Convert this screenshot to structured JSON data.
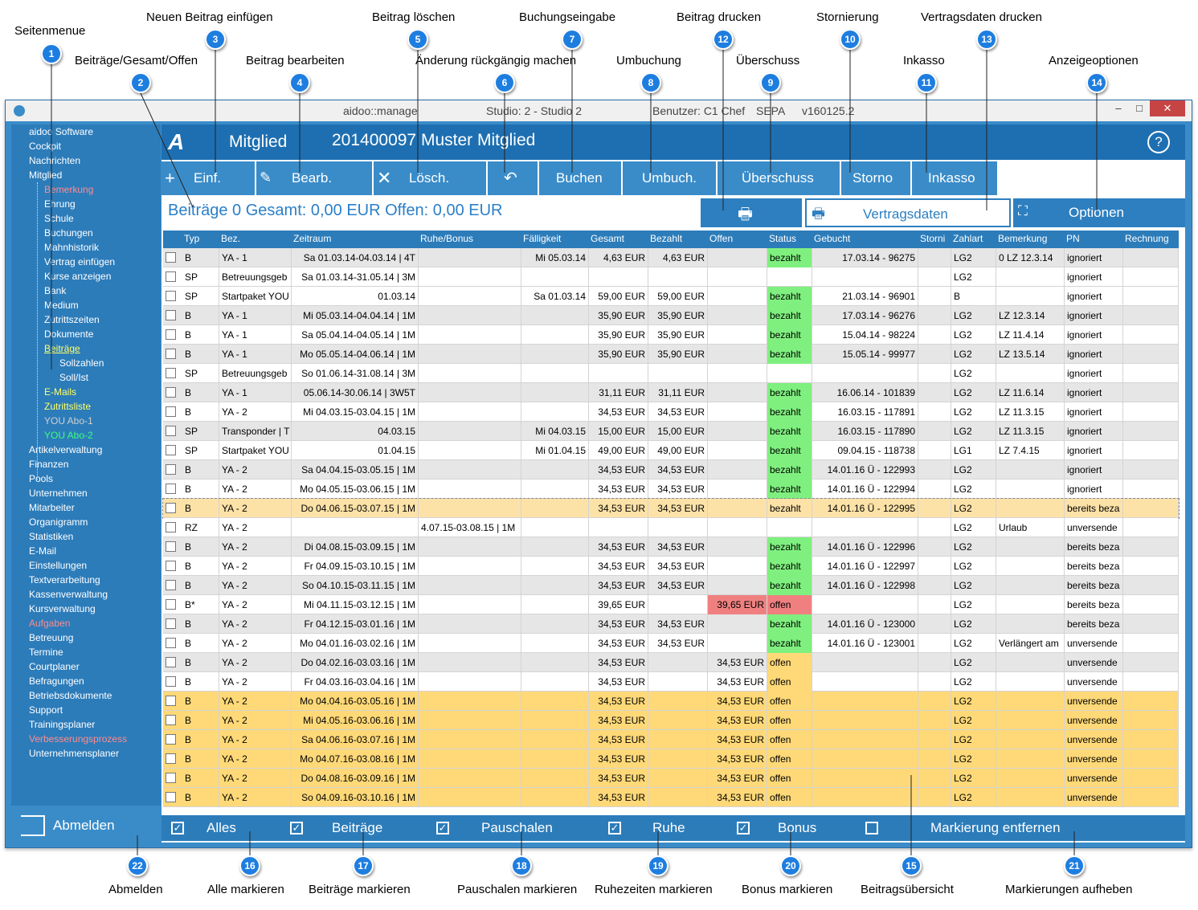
{
  "callouts": [
    {
      "n": "1",
      "text": "Seitenmenue"
    },
    {
      "n": "2",
      "text": "Beiträge/Gesamt/Offen"
    },
    {
      "n": "3",
      "text": "Neuen Beitrag einfügen"
    },
    {
      "n": "4",
      "text": "Beitrag bearbeiten"
    },
    {
      "n": "5",
      "text": "Beitrag löschen"
    },
    {
      "n": "6",
      "text": "Änderung rückgängig machen"
    },
    {
      "n": "7",
      "text": "Buchungseingabe"
    },
    {
      "n": "8",
      "text": "Umbuchung"
    },
    {
      "n": "9",
      "text": "Überschuss"
    },
    {
      "n": "10",
      "text": "Stornierung"
    },
    {
      "n": "11",
      "text": "Inkasso"
    },
    {
      "n": "12",
      "text": "Beitrag drucken"
    },
    {
      "n": "13",
      "text": "Vertragsdaten drucken"
    },
    {
      "n": "14",
      "text": "Anzeigeoptionen"
    },
    {
      "n": "15",
      "text": "Beitragsübersicht"
    },
    {
      "n": "16",
      "text": "Alle markieren"
    },
    {
      "n": "17",
      "text": "Beiträge markieren"
    },
    {
      "n": "18",
      "text": "Pauschalen markieren"
    },
    {
      "n": "19",
      "text": "Ruhezeiten markieren"
    },
    {
      "n": "20",
      "text": "Bonus markieren"
    },
    {
      "n": "21",
      "text": "Markierungen aufheben"
    },
    {
      "n": "22",
      "text": "Abmelden"
    }
  ],
  "window": {
    "app": "aidoo::manage",
    "studio": "Studio: 2 - Studio 2",
    "user": "Benutzer: C1 Chef",
    "mode": "SEPA",
    "version": "v160125.2"
  },
  "sidebar": {
    "items": [
      {
        "label": "aidoo Software",
        "color": "#ffffff"
      },
      {
        "label": "Cockpit",
        "color": "#ffffff"
      },
      {
        "label": "Nachrichten",
        "color": "#ffffff"
      },
      {
        "label": "Mitglied",
        "color": "#ffffff"
      },
      {
        "label": "Bemerkung",
        "color": "#ff8c8c"
      },
      {
        "label": "Ehrung",
        "color": "#ffffff"
      },
      {
        "label": "Schule",
        "color": "#ffffff"
      },
      {
        "label": "Buchungen",
        "color": "#ffffff"
      },
      {
        "label": "Mahnhistorik",
        "color": "#ffffff"
      },
      {
        "label": "Vertrag einfügen",
        "color": "#ffffff"
      },
      {
        "label": "Kurse anzeigen",
        "color": "#ffffff"
      },
      {
        "label": "Bank",
        "color": "#ffffff"
      },
      {
        "label": "Medium",
        "color": "#ffffff"
      },
      {
        "label": "Zutrittszeiten",
        "color": "#ffffff"
      },
      {
        "label": "Dokumente",
        "color": "#ffffff"
      },
      {
        "label": "Beiträge",
        "color": "#ffff66"
      },
      {
        "label": "Sollzahlen",
        "color": "#ffffff"
      },
      {
        "label": "Soll/Ist",
        "color": "#ffffff"
      },
      {
        "label": "E-Mails",
        "color": "#ffff66"
      },
      {
        "label": "Zutrittsliste",
        "color": "#ffff66"
      },
      {
        "label": "YOU Abo-1",
        "color": "#cfcfcf"
      },
      {
        "label": "YOU Abo-2",
        "color": "#3dff7a"
      },
      {
        "label": "Artikelverwaltung",
        "color": "#ffffff"
      },
      {
        "label": "Finanzen",
        "color": "#ffffff"
      },
      {
        "label": "Pools",
        "color": "#ffffff"
      },
      {
        "label": "Unternehmen",
        "color": "#ffffff"
      },
      {
        "label": "Mitarbeiter",
        "color": "#ffffff"
      },
      {
        "label": "Organigramm",
        "color": "#ffffff"
      },
      {
        "label": "Statistiken",
        "color": "#ffffff"
      },
      {
        "label": "E-Mail",
        "color": "#ffffff"
      },
      {
        "label": "Einstellungen",
        "color": "#ffffff"
      },
      {
        "label": "Textverarbeitung",
        "color": "#ffffff"
      },
      {
        "label": "Kassenverwaltung",
        "color": "#ffffff"
      },
      {
        "label": "Kursverwaltung",
        "color": "#ffffff"
      },
      {
        "label": "Aufgaben",
        "color": "#ff8c8c"
      },
      {
        "label": "Betreuung",
        "color": "#ffffff"
      },
      {
        "label": "Termine",
        "color": "#ffffff"
      },
      {
        "label": "Courtplaner",
        "color": "#ffffff"
      },
      {
        "label": "Befragungen",
        "color": "#ffffff"
      },
      {
        "label": "Betriebsdokumente",
        "color": "#ffffff"
      },
      {
        "label": "Support",
        "color": "#ffffff"
      },
      {
        "label": "Trainingsplaner",
        "color": "#ffffff"
      },
      {
        "label": "Verbesserungsprozess",
        "color": "#ff8c8c"
      },
      {
        "label": "Unternehmensplaner",
        "color": "#ffffff"
      }
    ],
    "logout": "Abmelden"
  },
  "header": {
    "section": "Mitglied",
    "member": "201400097  Muster Mitglied",
    "help": "?"
  },
  "toolbar": {
    "insert": "Einf.",
    "edit": "Bearb.",
    "delete": "Lösch.",
    "book": "Buchen",
    "rebook": "Umbuch.",
    "surplus": "Überschuss",
    "storno": "Storno",
    "collection": "Inkasso"
  },
  "summary": "Beiträge 0 Gesamt: 0,00 EUR Offen: 0,00 EUR",
  "contract_button": "Vertragsdaten",
  "options_button": "Optionen",
  "columns": [
    "Typ",
    "Bez.",
    "Zeitraum",
    "Ruhe/Bonus",
    "Fälligkeit",
    "Gesamt",
    "Bezahlt",
    "Offen",
    "Status",
    "Gebucht",
    "Storni",
    "Zahlart",
    "Bemerkung",
    "PN",
    "Rechnung"
  ],
  "rows": [
    {
      "typ": "B",
      "bez": "YA - 1",
      "zeitraum": "Sa 01.03.14-04.03.14 | 4T",
      "ruhe": "",
      "faellig": "Mi 05.03.14",
      "gesamt": "4,63 EUR",
      "bezahlt": "4,63 EUR",
      "offen": "",
      "status": "bezahlt",
      "gebucht": "17.03.14 - 96275",
      "storni": "",
      "zahlart": "LG2",
      "bemerkung": "0  LZ 12.3.14",
      "pn": "ignoriert",
      "rechnung": "",
      "bg": "#e6e6e6",
      "sbg": "#7ff07f",
      "obg": ""
    },
    {
      "typ": "SP",
      "bez": "Betreuungsgeb",
      "zeitraum": "Sa 01.03.14-31.05.14 | 3M",
      "ruhe": "",
      "faellig": "",
      "gesamt": "",
      "bezahlt": "",
      "offen": "",
      "status": "",
      "gebucht": "",
      "storni": "",
      "zahlart": "LG2",
      "bemerkung": "",
      "pn": "ignoriert",
      "rechnung": "",
      "bg": "#ffffff",
      "sbg": "",
      "obg": ""
    },
    {
      "typ": "SP",
      "bez": "Startpaket YOU",
      "zeitraum": "01.03.14",
      "ruhe": "",
      "faellig": "Sa 01.03.14",
      "gesamt": "59,00 EUR",
      "bezahlt": "59,00 EUR",
      "offen": "",
      "status": "bezahlt",
      "gebucht": "21.03.14 - 96901",
      "storni": "",
      "zahlart": "B",
      "bemerkung": "",
      "pn": "ignoriert",
      "rechnung": "",
      "bg": "#ffffff",
      "sbg": "#7ff07f",
      "obg": ""
    },
    {
      "typ": "B",
      "bez": "YA - 1",
      "zeitraum": "Mi 05.03.14-04.04.14 | 1M",
      "ruhe": "",
      "faellig": "",
      "gesamt": "35,90 EUR",
      "bezahlt": "35,90 EUR",
      "offen": "",
      "status": "bezahlt",
      "gebucht": "17.03.14 - 96276",
      "storni": "",
      "zahlart": "LG2",
      "bemerkung": "LZ 12.3.14",
      "pn": "ignoriert",
      "rechnung": "",
      "bg": "#e6e6e6",
      "sbg": "#7ff07f",
      "obg": ""
    },
    {
      "typ": "B",
      "bez": "YA - 1",
      "zeitraum": "Sa 05.04.14-04.05.14 | 1M",
      "ruhe": "",
      "faellig": "",
      "gesamt": "35,90 EUR",
      "bezahlt": "35,90 EUR",
      "offen": "",
      "status": "bezahlt",
      "gebucht": "15.04.14 - 98224",
      "storni": "",
      "zahlart": "LG2",
      "bemerkung": "LZ 11.4.14",
      "pn": "ignoriert",
      "rechnung": "",
      "bg": "#ffffff",
      "sbg": "#7ff07f",
      "obg": ""
    },
    {
      "typ": "B",
      "bez": "YA - 1",
      "zeitraum": "Mo 05.05.14-04.06.14 | 1M",
      "ruhe": "",
      "faellig": "",
      "gesamt": "35,90 EUR",
      "bezahlt": "35,90 EUR",
      "offen": "",
      "status": "bezahlt",
      "gebucht": "15.05.14 - 99977",
      "storni": "",
      "zahlart": "LG2",
      "bemerkung": "LZ 13.5.14",
      "pn": "ignoriert",
      "rechnung": "",
      "bg": "#e6e6e6",
      "sbg": "#7ff07f",
      "obg": ""
    },
    {
      "typ": "SP",
      "bez": "Betreuungsgeb",
      "zeitraum": "So 01.06.14-31.08.14 | 3M",
      "ruhe": "",
      "faellig": "",
      "gesamt": "",
      "bezahlt": "",
      "offen": "",
      "status": "",
      "gebucht": "",
      "storni": "",
      "zahlart": "LG2",
      "bemerkung": "",
      "pn": "ignoriert",
      "rechnung": "",
      "bg": "#ffffff",
      "sbg": "",
      "obg": ""
    },
    {
      "typ": "B",
      "bez": "YA - 1",
      "zeitraum": "05.06.14-30.06.14 | 3W5T",
      "ruhe": "",
      "faellig": "",
      "gesamt": "31,11 EUR",
      "bezahlt": "31,11 EUR",
      "offen": "",
      "status": "bezahlt",
      "gebucht": "16.06.14 - 101839",
      "storni": "",
      "zahlart": "LG2",
      "bemerkung": "LZ 11.6.14",
      "pn": "ignoriert",
      "rechnung": "",
      "bg": "#e6e6e6",
      "sbg": "#7ff07f",
      "obg": ""
    },
    {
      "typ": "B",
      "bez": "YA - 2",
      "zeitraum": "Mi 04.03.15-03.04.15 | 1M",
      "ruhe": "",
      "faellig": "",
      "gesamt": "34,53 EUR",
      "bezahlt": "34,53 EUR",
      "offen": "",
      "status": "bezahlt",
      "gebucht": "16.03.15 - 117891",
      "storni": "",
      "zahlart": "LG2",
      "bemerkung": "LZ 11.3.15",
      "pn": "ignoriert",
      "rechnung": "",
      "bg": "#ffffff",
      "sbg": "#7ff07f",
      "obg": ""
    },
    {
      "typ": "SP",
      "bez": "Transponder | T",
      "zeitraum": "04.03.15",
      "ruhe": "",
      "faellig": "Mi 04.03.15",
      "gesamt": "15,00 EUR",
      "bezahlt": "15,00 EUR",
      "offen": "",
      "status": "bezahlt",
      "gebucht": "16.03.15 - 117890",
      "storni": "",
      "zahlart": "LG2",
      "bemerkung": "LZ 11.3.15",
      "pn": "ignoriert",
      "rechnung": "",
      "bg": "#e6e6e6",
      "sbg": "#7ff07f",
      "obg": ""
    },
    {
      "typ": "SP",
      "bez": "Startpaket YOU",
      "zeitraum": "01.04.15",
      "ruhe": "",
      "faellig": "Mi 01.04.15",
      "gesamt": "49,00 EUR",
      "bezahlt": "49,00 EUR",
      "offen": "",
      "status": "bezahlt",
      "gebucht": "09.04.15 - 118738",
      "storni": "",
      "zahlart": "LG1",
      "bemerkung": "LZ 7.4.15",
      "pn": "ignoriert",
      "rechnung": "",
      "bg": "#ffffff",
      "sbg": "#7ff07f",
      "obg": ""
    },
    {
      "typ": "B",
      "bez": "YA - 2",
      "zeitraum": "Sa 04.04.15-03.05.15 | 1M",
      "ruhe": "",
      "faellig": "",
      "gesamt": "34,53 EUR",
      "bezahlt": "34,53 EUR",
      "offen": "",
      "status": "bezahlt",
      "gebucht": "14.01.16 Ü - 122993",
      "storni": "",
      "zahlart": "LG2",
      "bemerkung": "",
      "pn": "ignoriert",
      "rechnung": "",
      "bg": "#e6e6e6",
      "sbg": "#7ff07f",
      "obg": ""
    },
    {
      "typ": "B",
      "bez": "YA - 2",
      "zeitraum": "Mo 04.05.15-03.06.15 | 1M",
      "ruhe": "",
      "faellig": "",
      "gesamt": "34,53 EUR",
      "bezahlt": "34,53 EUR",
      "offen": "",
      "status": "bezahlt",
      "gebucht": "14.01.16 Ü - 122994",
      "storni": "",
      "zahlart": "LG2",
      "bemerkung": "",
      "pn": "ignoriert",
      "rechnung": "",
      "bg": "#ffffff",
      "sbg": "#7ff07f",
      "obg": ""
    },
    {
      "typ": "B",
      "bez": "YA - 2",
      "zeitraum": "Do 04.06.15-03.07.15 | 1M",
      "ruhe": "",
      "faellig": "",
      "gesamt": "34,53 EUR",
      "bezahlt": "34,53 EUR",
      "offen": "",
      "status": "bezahlt",
      "gebucht": "14.01.16 Ü - 122995",
      "storni": "",
      "zahlart": "LG2",
      "bemerkung": "",
      "pn": "bereits beza",
      "rechnung": "",
      "bg": "#fde2a8",
      "sbg": "",
      "obg": ""
    },
    {
      "typ": "RZ",
      "bez": "YA - 2",
      "zeitraum": "",
      "ruhe": "4.07.15-03.08.15 | 1M",
      "faellig": "",
      "gesamt": "",
      "bezahlt": "",
      "offen": "",
      "status": "",
      "gebucht": "",
      "storni": "",
      "zahlart": "LG2",
      "bemerkung": "Urlaub",
      "pn": "unversende",
      "rechnung": "",
      "bg": "#ffffff",
      "sbg": "",
      "obg": ""
    },
    {
      "typ": "B",
      "bez": "YA - 2",
      "zeitraum": "Di 04.08.15-03.09.15 | 1M",
      "ruhe": "",
      "faellig": "",
      "gesamt": "34,53 EUR",
      "bezahlt": "34,53 EUR",
      "offen": "",
      "status": "bezahlt",
      "gebucht": "14.01.16 Ü - 122996",
      "storni": "",
      "zahlart": "LG2",
      "bemerkung": "",
      "pn": "bereits beza",
      "rechnung": "",
      "bg": "#e6e6e6",
      "sbg": "#7ff07f",
      "obg": ""
    },
    {
      "typ": "B",
      "bez": "YA - 2",
      "zeitraum": "Fr 04.09.15-03.10.15 | 1M",
      "ruhe": "",
      "faellig": "",
      "gesamt": "34,53 EUR",
      "bezahlt": "34,53 EUR",
      "offen": "",
      "status": "bezahlt",
      "gebucht": "14.01.16 Ü - 122997",
      "storni": "",
      "zahlart": "LG2",
      "bemerkung": "",
      "pn": "bereits beza",
      "rechnung": "",
      "bg": "#ffffff",
      "sbg": "#7ff07f",
      "obg": ""
    },
    {
      "typ": "B",
      "bez": "YA - 2",
      "zeitraum": "So 04.10.15-03.11.15 | 1M",
      "ruhe": "",
      "faellig": "",
      "gesamt": "34,53 EUR",
      "bezahlt": "34,53 EUR",
      "offen": "",
      "status": "bezahlt",
      "gebucht": "14.01.16 Ü - 122998",
      "storni": "",
      "zahlart": "LG2",
      "bemerkung": "",
      "pn": "bereits beza",
      "rechnung": "",
      "bg": "#e6e6e6",
      "sbg": "#7ff07f",
      "obg": ""
    },
    {
      "typ": "B*",
      "bez": "YA - 2",
      "zeitraum": "Mi 04.11.15-03.12.15 | 1M",
      "ruhe": "",
      "faellig": "",
      "gesamt": "39,65 EUR",
      "bezahlt": "",
      "offen": "39,65 EUR",
      "status": "offen",
      "gebucht": "",
      "storni": "",
      "zahlart": "LG2",
      "bemerkung": "",
      "pn": "bereits beza",
      "rechnung": "",
      "bg": "#ffffff",
      "sbg": "#f08080",
      "obg": "#f08080"
    },
    {
      "typ": "B",
      "bez": "YA - 2",
      "zeitraum": "Fr 04.12.15-03.01.16 | 1M",
      "ruhe": "",
      "faellig": "",
      "gesamt": "34,53 EUR",
      "bezahlt": "34,53 EUR",
      "offen": "",
      "status": "bezahlt",
      "gebucht": "14.01.16 Ü - 123000",
      "storni": "",
      "zahlart": "LG2",
      "bemerkung": "",
      "pn": "bereits beza",
      "rechnung": "",
      "bg": "#e6e6e6",
      "sbg": "#7ff07f",
      "obg": ""
    },
    {
      "typ": "B",
      "bez": "YA - 2",
      "zeitraum": "Mo 04.01.16-03.02.16 | 1M",
      "ruhe": "",
      "faellig": "",
      "gesamt": "34,53 EUR",
      "bezahlt": "34,53 EUR",
      "offen": "",
      "status": "bezahlt",
      "gebucht": "14.01.16 Ü - 123001",
      "storni": "",
      "zahlart": "LG2",
      "bemerkung": "Verlängert am",
      "pn": "unversende",
      "rechnung": "",
      "bg": "#ffffff",
      "sbg": "#7ff07f",
      "obg": ""
    },
    {
      "typ": "B",
      "bez": "YA - 2",
      "zeitraum": "Do 04.02.16-03.03.16 | 1M",
      "ruhe": "",
      "faellig": "",
      "gesamt": "34,53 EUR",
      "bezahlt": "",
      "offen": "34,53 EUR",
      "status": "offen",
      "gebucht": "",
      "storni": "",
      "zahlart": "LG2",
      "bemerkung": "",
      "pn": "unversende",
      "rechnung": "",
      "bg": "#e6e6e6",
      "sbg": "#ffd978",
      "obg": ""
    },
    {
      "typ": "B",
      "bez": "YA - 2",
      "zeitraum": "Fr 04.03.16-03.04.16 | 1M",
      "ruhe": "",
      "faellig": "",
      "gesamt": "34,53 EUR",
      "bezahlt": "",
      "offen": "34,53 EUR",
      "status": "offen",
      "gebucht": "",
      "storni": "",
      "zahlart": "LG2",
      "bemerkung": "",
      "pn": "unversende",
      "rechnung": "",
      "bg": "#ffffff",
      "sbg": "#ffd978",
      "obg": ""
    },
    {
      "typ": "B",
      "bez": "YA - 2",
      "zeitraum": "Mo 04.04.16-03.05.16 | 1M",
      "ruhe": "",
      "faellig": "",
      "gesamt": "34,53 EUR",
      "bezahlt": "",
      "offen": "34,53 EUR",
      "status": "offen",
      "gebucht": "",
      "storni": "",
      "zahlart": "LG2",
      "bemerkung": "",
      "pn": "unversende",
      "rechnung": "",
      "bg": "#ffd978",
      "sbg": "",
      "obg": ""
    },
    {
      "typ": "B",
      "bez": "YA - 2",
      "zeitraum": "Mi 04.05.16-03.06.16 | 1M",
      "ruhe": "",
      "faellig": "",
      "gesamt": "34,53 EUR",
      "bezahlt": "",
      "offen": "34,53 EUR",
      "status": "offen",
      "gebucht": "",
      "storni": "",
      "zahlart": "LG2",
      "bemerkung": "",
      "pn": "unversende",
      "rechnung": "",
      "bg": "#ffd978",
      "sbg": "",
      "obg": ""
    },
    {
      "typ": "B",
      "bez": "YA - 2",
      "zeitraum": "Sa 04.06.16-03.07.16 | 1M",
      "ruhe": "",
      "faellig": "",
      "gesamt": "34,53 EUR",
      "bezahlt": "",
      "offen": "34,53 EUR",
      "status": "offen",
      "gebucht": "",
      "storni": "",
      "zahlart": "LG2",
      "bemerkung": "",
      "pn": "unversende",
      "rechnung": "",
      "bg": "#ffd978",
      "sbg": "",
      "obg": ""
    },
    {
      "typ": "B",
      "bez": "YA - 2",
      "zeitraum": "Mo 04.07.16-03.08.16 | 1M",
      "ruhe": "",
      "faellig": "",
      "gesamt": "34,53 EUR",
      "bezahlt": "",
      "offen": "34,53 EUR",
      "status": "offen",
      "gebucht": "",
      "storni": "",
      "zahlart": "LG2",
      "bemerkung": "",
      "pn": "unversende",
      "rechnung": "",
      "bg": "#ffd978",
      "sbg": "",
      "obg": ""
    },
    {
      "typ": "B",
      "bez": "YA - 2",
      "zeitraum": "Do 04.08.16-03.09.16 | 1M",
      "ruhe": "",
      "faellig": "",
      "gesamt": "34,53 EUR",
      "bezahlt": "",
      "offen": "34,53 EUR",
      "status": "offen",
      "gebucht": "",
      "storni": "",
      "zahlart": "LG2",
      "bemerkung": "",
      "pn": "unversende",
      "rechnung": "",
      "bg": "#ffd978",
      "sbg": "",
      "obg": ""
    },
    {
      "typ": "B",
      "bez": "YA - 2",
      "zeitraum": "So 04.09.16-03.10.16 | 1M",
      "ruhe": "",
      "faellig": "",
      "gesamt": "34,53 EUR",
      "bezahlt": "",
      "offen": "34,53 EUR",
      "status": "offen",
      "gebucht": "",
      "storni": "",
      "zahlart": "LG2",
      "bemerkung": "",
      "pn": "unversende",
      "rechnung": "",
      "bg": "#ffd978",
      "sbg": "",
      "obg": ""
    }
  ],
  "bottombar": {
    "all": "Alles",
    "contributions": "Beiträge",
    "flatrates": "Pauschalen",
    "rest": "Ruhe",
    "bonus": "Bonus",
    "remove": "Markierung entfernen",
    "check": "✓"
  }
}
